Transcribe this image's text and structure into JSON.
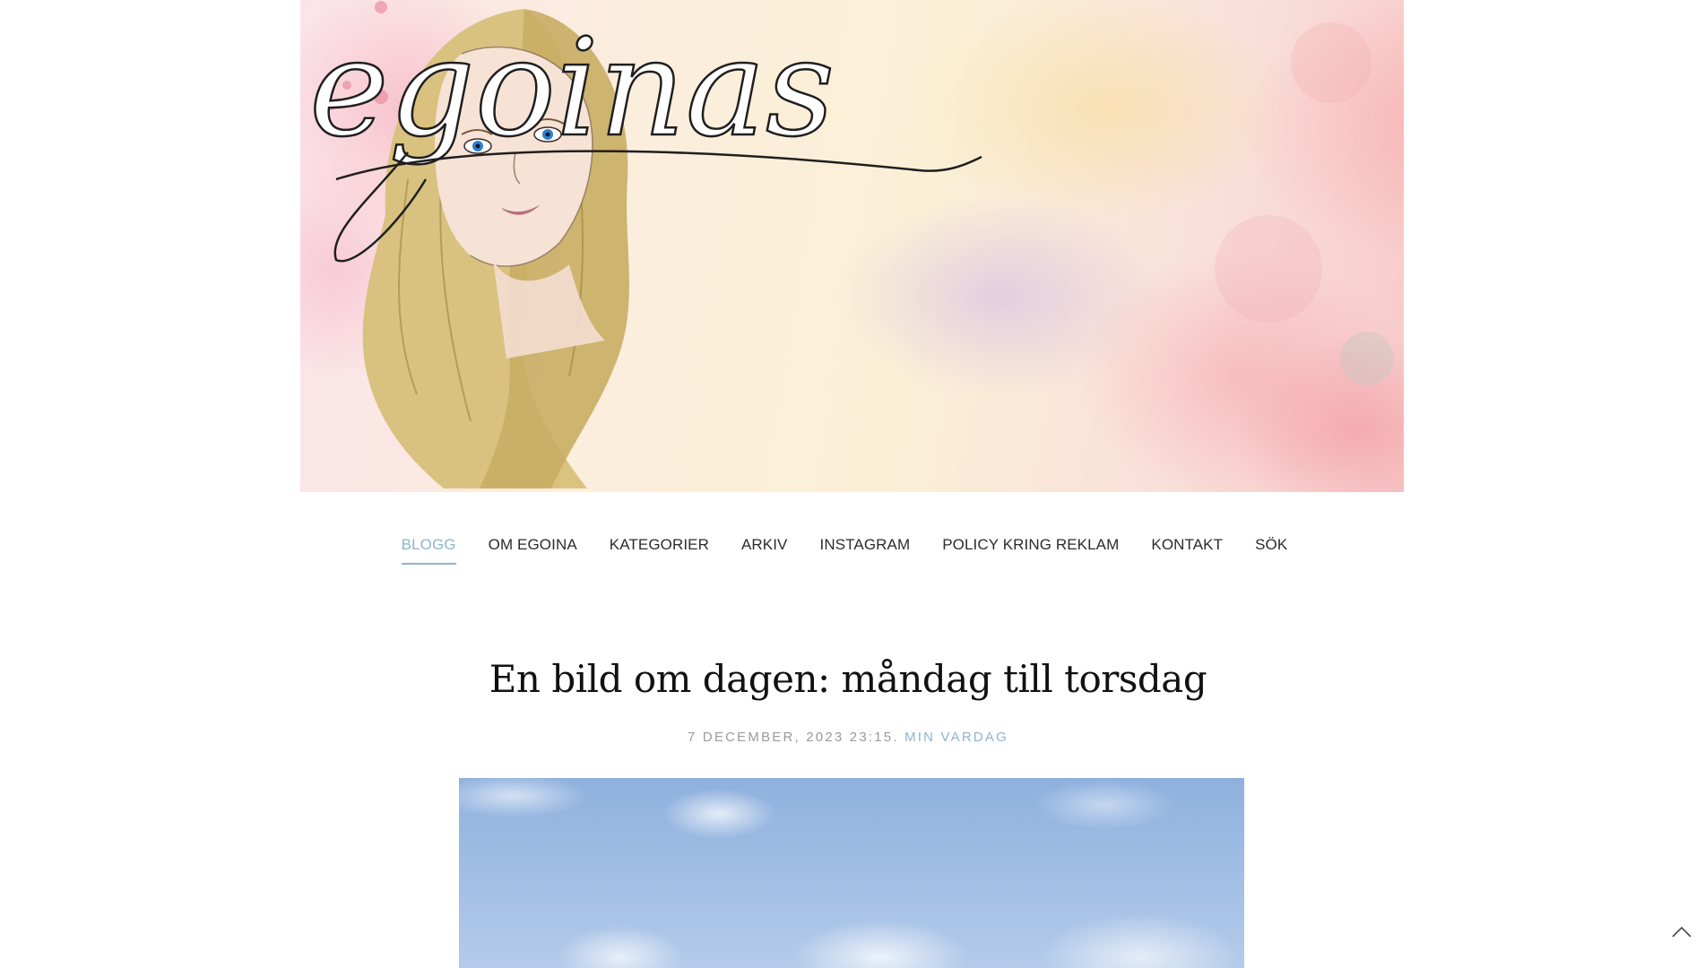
{
  "banner": {
    "logo_text": "egoinas"
  },
  "nav": {
    "items": [
      {
        "label": "BLOGG",
        "active": true
      },
      {
        "label": "OM EGOINA",
        "active": false
      },
      {
        "label": "KATEGORIER",
        "active": false
      },
      {
        "label": "ARKIV",
        "active": false
      },
      {
        "label": "INSTAGRAM",
        "active": false
      },
      {
        "label": "POLICY KRING REKLAM",
        "active": false
      },
      {
        "label": "KONTAKT",
        "active": false
      },
      {
        "label": "SÖK",
        "active": false
      }
    ]
  },
  "post": {
    "title": "En bild om dagen: måndag till torsdag",
    "date": "7 DECEMBER, 2023 23:15.",
    "category": "MIN VARDAG"
  },
  "colors": {
    "accent": "#8eb4cc",
    "text": "#2b2b2b",
    "meta": "#9a9a9a"
  },
  "icons": {
    "scroll_top": "chevron-up-icon"
  }
}
